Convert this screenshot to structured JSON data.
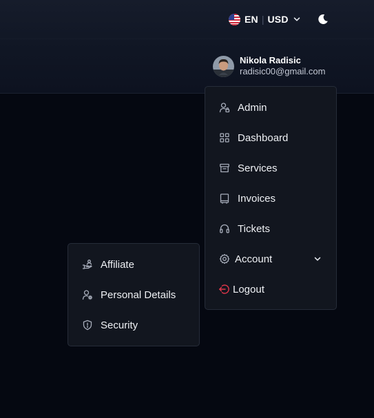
{
  "header": {
    "locale": {
      "language": "EN",
      "separator": "|",
      "currency": "USD",
      "flag_icon": "us-flag-icon"
    },
    "theme_toggle_icon": "moon-icon",
    "user": {
      "name": "Nikola Radisic",
      "email": "radisic00@gmail.com"
    }
  },
  "user_menu": {
    "items": [
      {
        "label": "Admin",
        "icon": "user-admin-icon"
      },
      {
        "label": "Dashboard",
        "icon": "grid-icon"
      },
      {
        "label": "Services",
        "icon": "archive-icon"
      },
      {
        "label": "Invoices",
        "icon": "invoice-icon"
      },
      {
        "label": "Tickets",
        "icon": "headset-icon"
      },
      {
        "label": "Account",
        "icon": "gear-icon"
      },
      {
        "label": "Logout",
        "icon": "logout-icon"
      }
    ]
  },
  "account_submenu": {
    "items": [
      {
        "label": "Affiliate",
        "icon": "affiliate-icon"
      },
      {
        "label": "Personal Details",
        "icon": "user-settings-icon"
      },
      {
        "label": "Security",
        "icon": "shield-icon"
      }
    ]
  },
  "colors": {
    "background": "#050811",
    "panel": "#12161f",
    "logout_accent": "#e0364a"
  }
}
